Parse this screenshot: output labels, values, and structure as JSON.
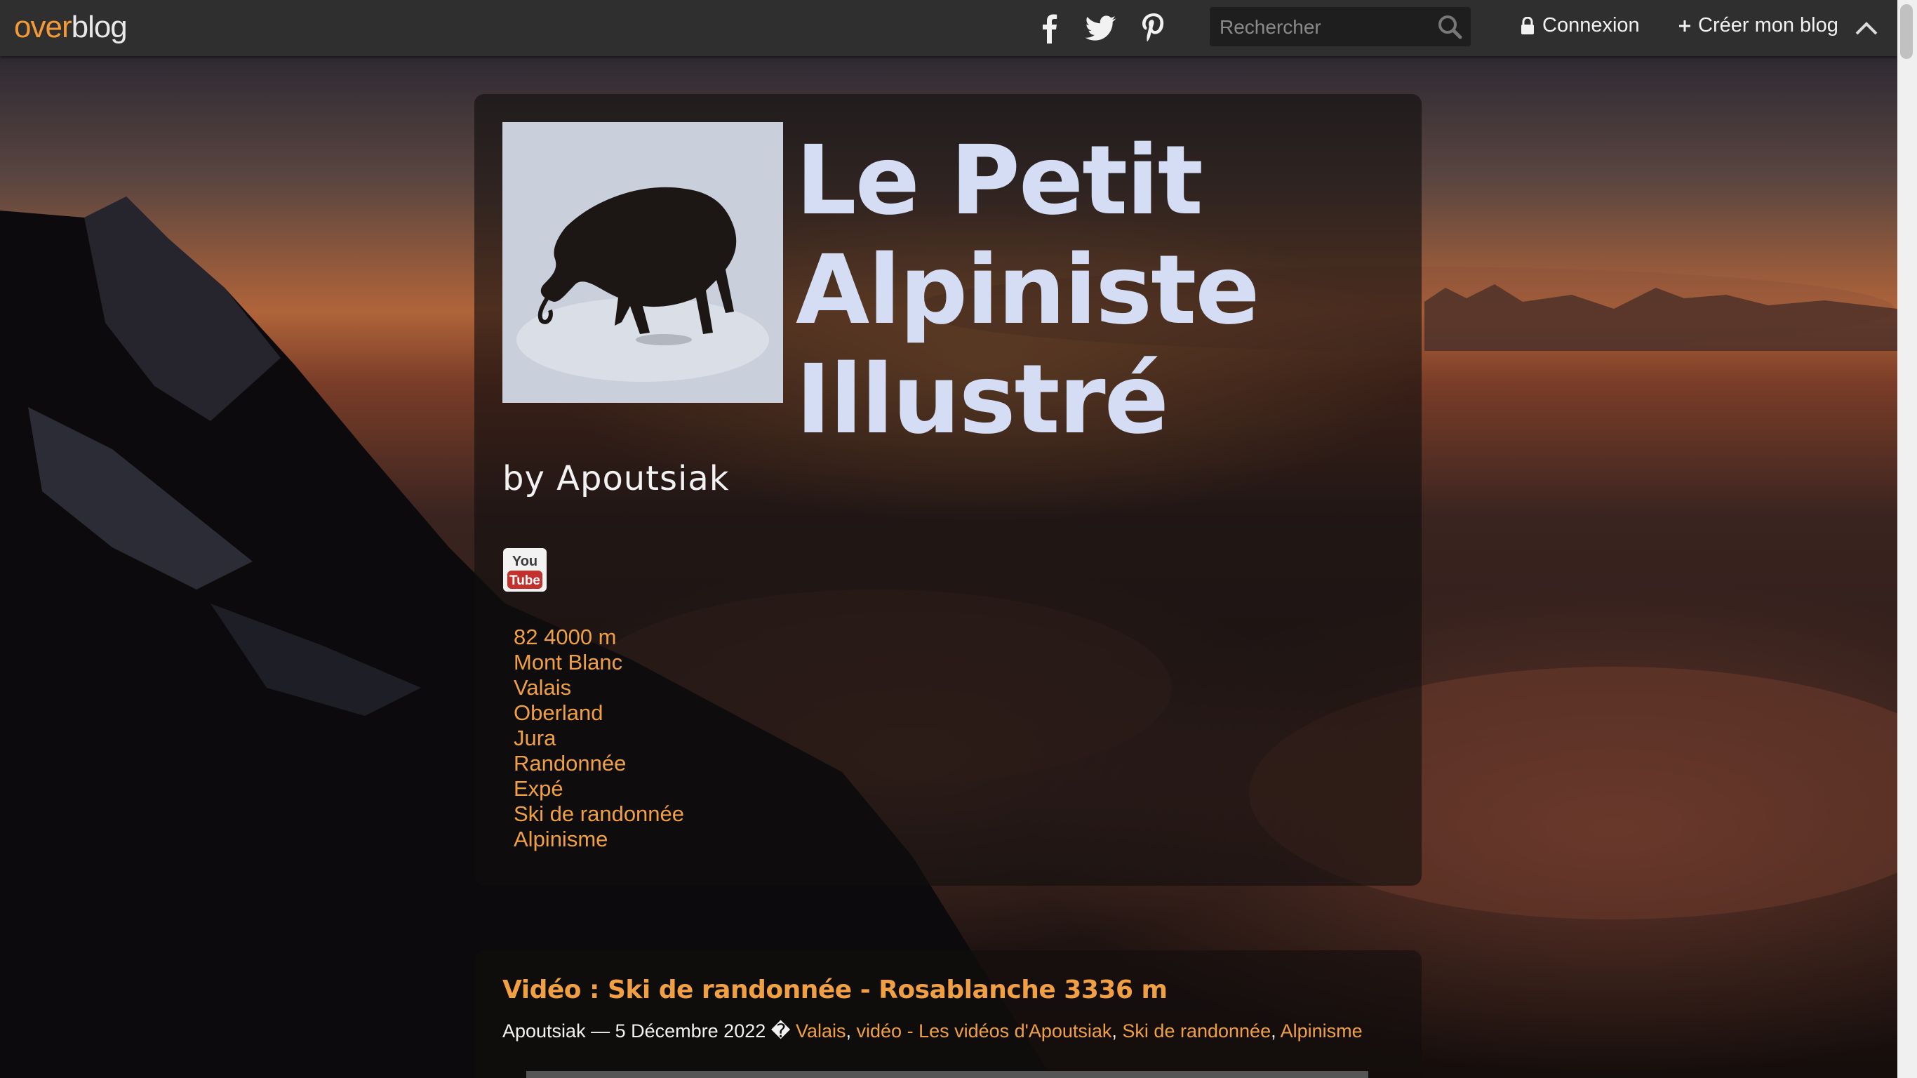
{
  "topbar": {
    "logo_over": "over",
    "logo_blog": "blog",
    "social": [
      "facebook-icon",
      "twitter-icon",
      "pinterest-icon"
    ],
    "search_placeholder": "Rechercher",
    "login_label": "Connexion",
    "create_label": "Créer mon blog"
  },
  "header": {
    "title": "Le Petit Alpiniste Illustré",
    "title_lines": [
      "Le Petit",
      "Alpiniste",
      "Illustré"
    ],
    "subtitle": "by Apoutsiak",
    "youtube_top": "You",
    "youtube_bottom": "Tube",
    "categories": [
      "82 4000 m",
      "Mont Blanc",
      "Valais",
      "Oberland",
      "Jura",
      "Randonnée",
      "Expé",
      "Ski de randonnée",
      "Alpinisme"
    ]
  },
  "article": {
    "title": "Vidéo : Ski de randonnée - Rosablanche 3336 m",
    "author": "Apoutsiak",
    "dash": "—",
    "date": "5 Décembre 2022",
    "separator": "�",
    "tags": [
      "Valais",
      "vidéo - Les vidéos d'Apoutsiak",
      "Ski de randonnée",
      "Alpinisme"
    ]
  },
  "colors": {
    "accent": "#f0a043",
    "title": "#d4ddf3",
    "topbar": "#2f2f2f"
  }
}
